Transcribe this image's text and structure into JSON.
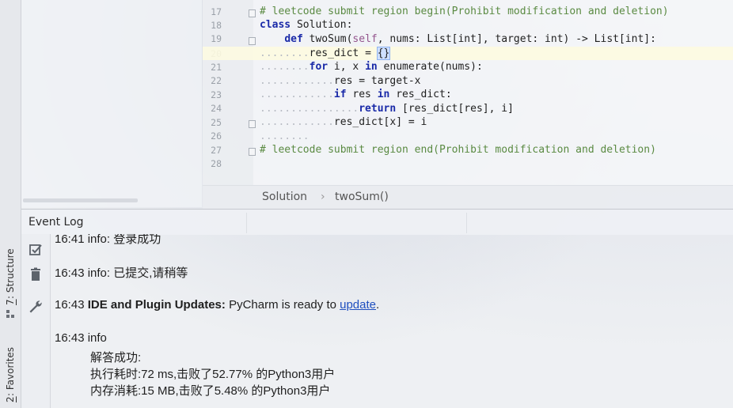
{
  "sidebar": {
    "structure_tab_key": "7",
    "structure_tab_label": ": Structure",
    "favorites_tab_key": "2",
    "favorites_tab_label": ": Favorites"
  },
  "editor": {
    "line_numbers": [
      "17",
      "18",
      "19",
      "20",
      "21",
      "22",
      "23",
      "24",
      "25",
      "26",
      "27",
      "28"
    ],
    "lines": {
      "l17_comment": "# leetcode submit region begin(Prohibit modification and deletion)",
      "l18_kw": "class",
      "l18_name": " Solution:",
      "l19_indent": "    ",
      "l19_kw": "def",
      "l19_mid1": " twoSum(",
      "l19_self": "self",
      "l19_mid2": ", nums: List[int], target: int) -> List[int]:",
      "l20_ws": "........",
      "l20_text": "res_dict = ",
      "l20_sel": "{}",
      "l21_ws": "........",
      "l21_kw1": "for",
      "l21_mid": " i, x ",
      "l21_kw2": "in",
      "l21_end": " enumerate(nums):",
      "l22_ws": "............",
      "l22_text": "res = target-x",
      "l23_ws": "............",
      "l23_kw1": "if",
      "l23_mid": " res ",
      "l23_kw2": "in",
      "l23_end": " res_dict:",
      "l24_ws": "................",
      "l24_kw": "return",
      "l24_end": " [res_dict[res], i]",
      "l25_ws": "............",
      "l25_text": "res_dict[x] = i",
      "l26_ws": "........",
      "l27_comment": "# leetcode submit region end(Prohibit modification and deletion)"
    }
  },
  "breadcrumb": {
    "class": "Solution",
    "separator": "›",
    "method": "twoSum()"
  },
  "event_log": {
    "title": "Event Log",
    "entries": {
      "e1_time": "16:41",
      "e1_text": " info: 登录成功",
      "e2_time": "16:43",
      "e2_text": " info: 已提交,请稍等",
      "e3_time": "16:43",
      "e3_bold": " IDE and Plugin Updates:",
      "e3_text": " PyCharm is ready to ",
      "e3_link": "update",
      "e3_end": ".",
      "e4_time": "16:43",
      "e4_text": " info",
      "e4_line1": "解答成功:",
      "e4_line2": "执行耗时:72 ms,击败了52.77% 的Python3用户",
      "e4_line3": "内存消耗:15 MB,击败了5.48% 的Python3用户"
    }
  },
  "icons": {
    "mark_read": "check-box-icon",
    "delete": "trash-icon",
    "settings": "wrench-icon",
    "structure": "structure-icon"
  }
}
